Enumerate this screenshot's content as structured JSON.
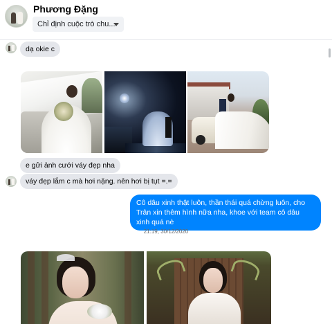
{
  "header": {
    "contact_name": "Phương Đặng",
    "dropdown_label": "Chỉ định cuộc trò chu..."
  },
  "messages": {
    "m1": "dạ okie c",
    "m2": "e gửi ảnh cưới váy đẹp nha",
    "m3": "váy đẹp lắm c mà hơi nặng. nên hơi bị tụt =.=",
    "m4": "Cô dâu xinh thật luôn, thần thái quá chừng luôn, cho Trân xin thêm hình nữa nha, khoe với team cô dâu xinh quá nè"
  },
  "timestamp": "21:19, 30/12/2020",
  "colors": {
    "outgoing_bubble": "#0084ff",
    "incoming_bubble": "#e4e6eb"
  }
}
